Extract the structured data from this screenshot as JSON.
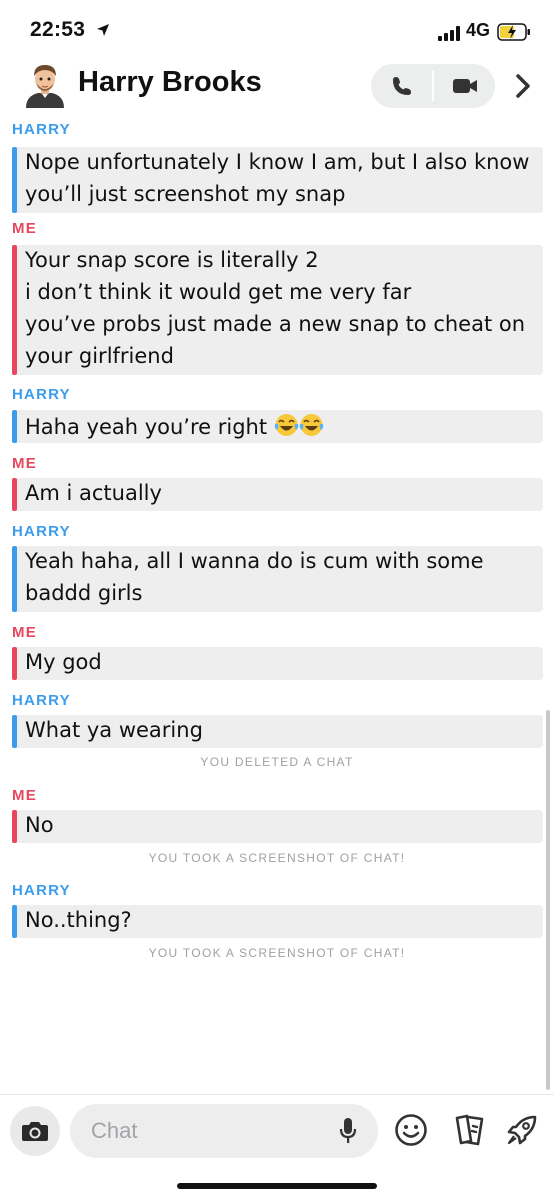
{
  "status_bar": {
    "time": "22:53",
    "network": "4G"
  },
  "header": {
    "title": "Harry Brooks"
  },
  "messages": [
    {
      "sender": "HARRY",
      "lines": [
        "Nope unfortunately I know I am, but I also know",
        "you’ll just screenshot my snap"
      ]
    },
    {
      "sender": "ME",
      "lines": [
        "Your snap score is literally 2",
        "i don’t think it would get me very far",
        "you’ve probs just made a new snap to cheat on",
        "your girlfriend"
      ]
    },
    {
      "sender": "HARRY",
      "lines": [
        "Haha yeah you’re right "
      ]
    },
    {
      "sender": "ME",
      "lines": [
        "Am i actually"
      ]
    },
    {
      "sender": "HARRY",
      "lines": [
        "Yeah haha, all I wanna do is cum with some",
        "baddd girls"
      ]
    },
    {
      "sender": "ME",
      "lines": [
        "My god"
      ]
    },
    {
      "sender": "HARRY",
      "lines": [
        "What ya wearing"
      ]
    },
    {
      "sender": "ME",
      "lines": [
        "No"
      ]
    },
    {
      "sender": "HARRY",
      "lines": [
        "No..thing?"
      ]
    }
  ],
  "system_notes": [
    "YOU DELETED A CHAT",
    "YOU TOOK A SCREENSHOT OF CHAT!",
    "YOU TOOK A SCREENSHOT OF CHAT!"
  ],
  "composer": {
    "placeholder": "Chat"
  },
  "colors": {
    "harry": "#3c9cec",
    "me": "#e8475e",
    "bubble": "#eeeeef"
  },
  "icons": [
    "location-arrow-icon",
    "signal-icon",
    "battery-charging-icon",
    "bitmoji-avatar",
    "phone-icon",
    "video-icon",
    "chevron-right-icon",
    "crying-laughing-emoji",
    "camera-icon",
    "microphone-icon",
    "smiley-icon",
    "cards-icon",
    "rocket-icon"
  ]
}
